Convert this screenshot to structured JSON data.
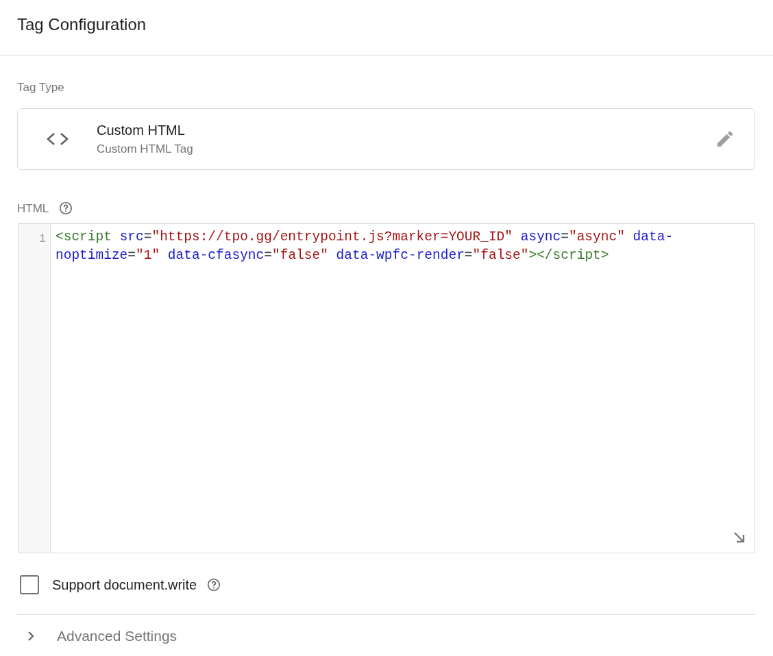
{
  "header": {
    "title": "Tag Configuration"
  },
  "tag_type": {
    "label": "Tag Type",
    "name": "Custom HTML",
    "description": "Custom HTML Tag"
  },
  "html": {
    "label": "HTML",
    "lines": [
      {
        "number": "1",
        "text": "<script src=\"https://tpo.gg/entrypoint.js?marker=YOUR_ID\" async=\"async\" data-noptimize=\"1\" data-cfasync=\"false\" data-wpfc-render=\"false\"></script>"
      }
    ]
  },
  "support_document_write": {
    "label": "Support document.write",
    "checked": false
  },
  "advanced_settings": {
    "label": "Advanced Settings",
    "expanded": false
  }
}
